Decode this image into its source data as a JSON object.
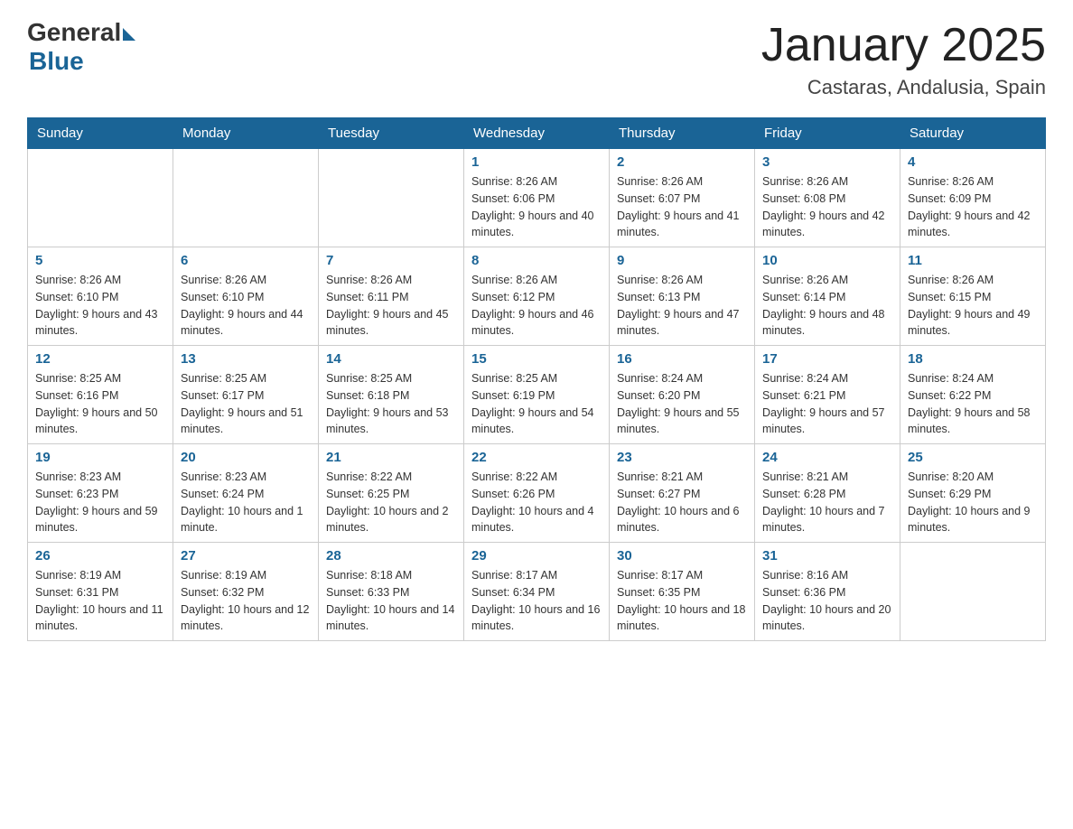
{
  "logo": {
    "general": "General",
    "blue": "Blue"
  },
  "header": {
    "title": "January 2025",
    "subtitle": "Castaras, Andalusia, Spain"
  },
  "days": [
    "Sunday",
    "Monday",
    "Tuesday",
    "Wednesday",
    "Thursday",
    "Friday",
    "Saturday"
  ],
  "weeks": [
    [
      {
        "day": "",
        "info": ""
      },
      {
        "day": "",
        "info": ""
      },
      {
        "day": "",
        "info": ""
      },
      {
        "day": "1",
        "info": "Sunrise: 8:26 AM\nSunset: 6:06 PM\nDaylight: 9 hours and 40 minutes."
      },
      {
        "day": "2",
        "info": "Sunrise: 8:26 AM\nSunset: 6:07 PM\nDaylight: 9 hours and 41 minutes."
      },
      {
        "day": "3",
        "info": "Sunrise: 8:26 AM\nSunset: 6:08 PM\nDaylight: 9 hours and 42 minutes."
      },
      {
        "day": "4",
        "info": "Sunrise: 8:26 AM\nSunset: 6:09 PM\nDaylight: 9 hours and 42 minutes."
      }
    ],
    [
      {
        "day": "5",
        "info": "Sunrise: 8:26 AM\nSunset: 6:10 PM\nDaylight: 9 hours and 43 minutes."
      },
      {
        "day": "6",
        "info": "Sunrise: 8:26 AM\nSunset: 6:10 PM\nDaylight: 9 hours and 44 minutes."
      },
      {
        "day": "7",
        "info": "Sunrise: 8:26 AM\nSunset: 6:11 PM\nDaylight: 9 hours and 45 minutes."
      },
      {
        "day": "8",
        "info": "Sunrise: 8:26 AM\nSunset: 6:12 PM\nDaylight: 9 hours and 46 minutes."
      },
      {
        "day": "9",
        "info": "Sunrise: 8:26 AM\nSunset: 6:13 PM\nDaylight: 9 hours and 47 minutes."
      },
      {
        "day": "10",
        "info": "Sunrise: 8:26 AM\nSunset: 6:14 PM\nDaylight: 9 hours and 48 minutes."
      },
      {
        "day": "11",
        "info": "Sunrise: 8:26 AM\nSunset: 6:15 PM\nDaylight: 9 hours and 49 minutes."
      }
    ],
    [
      {
        "day": "12",
        "info": "Sunrise: 8:25 AM\nSunset: 6:16 PM\nDaylight: 9 hours and 50 minutes."
      },
      {
        "day": "13",
        "info": "Sunrise: 8:25 AM\nSunset: 6:17 PM\nDaylight: 9 hours and 51 minutes."
      },
      {
        "day": "14",
        "info": "Sunrise: 8:25 AM\nSunset: 6:18 PM\nDaylight: 9 hours and 53 minutes."
      },
      {
        "day": "15",
        "info": "Sunrise: 8:25 AM\nSunset: 6:19 PM\nDaylight: 9 hours and 54 minutes."
      },
      {
        "day": "16",
        "info": "Sunrise: 8:24 AM\nSunset: 6:20 PM\nDaylight: 9 hours and 55 minutes."
      },
      {
        "day": "17",
        "info": "Sunrise: 8:24 AM\nSunset: 6:21 PM\nDaylight: 9 hours and 57 minutes."
      },
      {
        "day": "18",
        "info": "Sunrise: 8:24 AM\nSunset: 6:22 PM\nDaylight: 9 hours and 58 minutes."
      }
    ],
    [
      {
        "day": "19",
        "info": "Sunrise: 8:23 AM\nSunset: 6:23 PM\nDaylight: 9 hours and 59 minutes."
      },
      {
        "day": "20",
        "info": "Sunrise: 8:23 AM\nSunset: 6:24 PM\nDaylight: 10 hours and 1 minute."
      },
      {
        "day": "21",
        "info": "Sunrise: 8:22 AM\nSunset: 6:25 PM\nDaylight: 10 hours and 2 minutes."
      },
      {
        "day": "22",
        "info": "Sunrise: 8:22 AM\nSunset: 6:26 PM\nDaylight: 10 hours and 4 minutes."
      },
      {
        "day": "23",
        "info": "Sunrise: 8:21 AM\nSunset: 6:27 PM\nDaylight: 10 hours and 6 minutes."
      },
      {
        "day": "24",
        "info": "Sunrise: 8:21 AM\nSunset: 6:28 PM\nDaylight: 10 hours and 7 minutes."
      },
      {
        "day": "25",
        "info": "Sunrise: 8:20 AM\nSunset: 6:29 PM\nDaylight: 10 hours and 9 minutes."
      }
    ],
    [
      {
        "day": "26",
        "info": "Sunrise: 8:19 AM\nSunset: 6:31 PM\nDaylight: 10 hours and 11 minutes."
      },
      {
        "day": "27",
        "info": "Sunrise: 8:19 AM\nSunset: 6:32 PM\nDaylight: 10 hours and 12 minutes."
      },
      {
        "day": "28",
        "info": "Sunrise: 8:18 AM\nSunset: 6:33 PM\nDaylight: 10 hours and 14 minutes."
      },
      {
        "day": "29",
        "info": "Sunrise: 8:17 AM\nSunset: 6:34 PM\nDaylight: 10 hours and 16 minutes."
      },
      {
        "day": "30",
        "info": "Sunrise: 8:17 AM\nSunset: 6:35 PM\nDaylight: 10 hours and 18 minutes."
      },
      {
        "day": "31",
        "info": "Sunrise: 8:16 AM\nSunset: 6:36 PM\nDaylight: 10 hours and 20 minutes."
      },
      {
        "day": "",
        "info": ""
      }
    ]
  ]
}
